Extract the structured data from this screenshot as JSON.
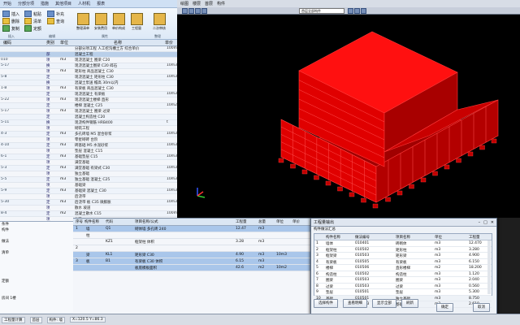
{
  "left_app": {
    "ribbon_tabs": [
      "开始",
      "分部分项",
      "措施",
      "其他项目",
      "人材机",
      "报表"
    ],
    "small_buttons": [
      "插入",
      "删除",
      "复制",
      "粘贴",
      "清单",
      "定额",
      "补充",
      "查询"
    ],
    "big_buttons": [
      "整理清单",
      "安装费用",
      "单价构成",
      "工程量",
      "二次审核"
    ],
    "groups": [
      "插入",
      "编辑",
      "属性",
      "整理"
    ],
    "headers": [
      "编码",
      "类别",
      "单位",
      "名称",
      "单价"
    ],
    "rows": [
      {
        "no": "",
        "type": "",
        "unit": "",
        "name": "分部分项工程 人工挖沟槽土方 综合单价",
        "qty": "100m3",
        "hl": false
      },
      {
        "no": "",
        "type": "部",
        "unit": "",
        "name": "混凝土工程",
        "qty": "",
        "hl": true
      },
      {
        "no": "010",
        "type": "项",
        "unit": "m3",
        "name": "现浇混凝土 圈梁 C20",
        "qty": "",
        "hl": false
      },
      {
        "no": "5-17",
        "type": "换",
        "unit": "",
        "name": "现浇混凝土圈梁 C20 碎石",
        "qty": "10m3",
        "hl": false
      },
      {
        "no": "",
        "type": "项",
        "unit": "m3",
        "name": "矩形柱 商品混凝土 C30",
        "qty": "",
        "hl": false
      },
      {
        "no": "5-8",
        "type": "定",
        "unit": "",
        "name": "现浇混凝土 矩形柱 C30",
        "qty": "10m3",
        "hl": false
      },
      {
        "no": "",
        "type": "换",
        "unit": "",
        "name": "混凝土泵送 檐高 30m以内",
        "qty": "",
        "hl": false
      },
      {
        "no": "1-B",
        "type": "项",
        "unit": "m3",
        "name": "有梁板 商品混凝土 C30",
        "qty": "",
        "hl": false
      },
      {
        "no": "",
        "type": "定",
        "unit": "",
        "name": "现浇混凝土 有梁板",
        "qty": "10m3",
        "hl": false
      },
      {
        "no": "5-22",
        "type": "项",
        "unit": "m3",
        "name": "现浇混凝土楼梯 直形",
        "qty": "",
        "hl": false
      },
      {
        "no": "",
        "type": "定",
        "unit": "",
        "name": "楼梯 混凝土 C25",
        "qty": "10m2",
        "hl": false
      },
      {
        "no": "5-17",
        "type": "项",
        "unit": "m3",
        "name": "现浇混凝土 圈梁 过梁",
        "qty": "",
        "hl": false
      },
      {
        "no": "",
        "type": "定",
        "unit": "",
        "name": "混凝土构造柱 C20",
        "qty": "",
        "hl": false
      },
      {
        "no": "5-11",
        "type": "换",
        "unit": "",
        "name": "现浇构件钢筋 HRB400",
        "qty": "t",
        "hl": false
      },
      {
        "no": "",
        "type": "项",
        "unit": "",
        "name": "砌筑工程",
        "qty": "",
        "hl": false
      },
      {
        "no": "4-3",
        "type": "定",
        "unit": "m3",
        "name": "多孔砖墙 M5 混合砂浆",
        "qty": "10m3",
        "hl": false
      },
      {
        "no": "",
        "type": "项",
        "unit": "",
        "name": "零星砌砖 台阶",
        "qty": "",
        "hl": false
      },
      {
        "no": "4-10",
        "type": "定",
        "unit": "m3",
        "name": "砖基础 M5 水泥砂浆",
        "qty": "10m3",
        "hl": false
      },
      {
        "no": "",
        "type": "项",
        "unit": "",
        "name": "垫层 混凝土 C15",
        "qty": "",
        "hl": false
      },
      {
        "no": "6-1",
        "type": "定",
        "unit": "m3",
        "name": "基础垫层 C15",
        "qty": "10m3",
        "hl": false
      },
      {
        "no": "",
        "type": "项",
        "unit": "",
        "name": "满堂基础",
        "qty": "",
        "hl": false
      },
      {
        "no": "5-3",
        "type": "定",
        "unit": "m3",
        "name": "满堂基础 有梁式 C30",
        "qty": "10m3",
        "hl": false
      },
      {
        "no": "",
        "type": "项",
        "unit": "",
        "name": "独立基础",
        "qty": "",
        "hl": false
      },
      {
        "no": "5-5",
        "type": "定",
        "unit": "m3",
        "name": "独立基础 混凝土 C25",
        "qty": "10m3",
        "hl": false
      },
      {
        "no": "",
        "type": "项",
        "unit": "",
        "name": "基础梁",
        "qty": "",
        "hl": false
      },
      {
        "no": "5-9",
        "type": "定",
        "unit": "m3",
        "name": "基础梁 混凝土 C30",
        "qty": "10m3",
        "hl": false
      },
      {
        "no": "",
        "type": "项",
        "unit": "",
        "name": "后浇带",
        "qty": "",
        "hl": false
      },
      {
        "no": "5-30",
        "type": "定",
        "unit": "m3",
        "name": "后浇带 板 C35 微膨胀",
        "qty": "10m3",
        "hl": false
      },
      {
        "no": "",
        "type": "项",
        "unit": "",
        "name": "散水 坡道",
        "qty": "",
        "hl": false
      },
      {
        "no": "8-4",
        "type": "定",
        "unit": "m2",
        "name": "混凝土散水 C15",
        "qty": "100m2",
        "hl": false
      },
      {
        "no": "",
        "type": "项",
        "unit": "",
        "name": "台阶",
        "qty": "",
        "hl": false
      },
      {
        "no": "8-9",
        "type": "定",
        "unit": "m2",
        "name": "混凝土台阶 C20",
        "qty": "10m2",
        "hl": false
      },
      {
        "no": "",
        "type": "项",
        "unit": "",
        "name": "压顶",
        "qty": "",
        "hl": false
      },
      {
        "no": "5-40",
        "type": "定",
        "unit": "m3",
        "name": "压顶 混凝土 C20",
        "qty": "10m3",
        "hl": false
      }
    ],
    "bottom_items": [
      "条件",
      "构件",
      "",
      "做法",
      "",
      "清单",
      "",
      "",
      "",
      "",
      "定额",
      "",
      "",
      "房间 1楼"
    ]
  },
  "viewport": {
    "tabs": [
      "绘图",
      "楼层",
      "首层",
      "构件"
    ],
    "view_select": "首层全部构件",
    "model_color": "#e00000"
  },
  "lower_table": {
    "headers": [
      "序号",
      "构件名称",
      "代码",
      "项目名称/公式",
      "工程量",
      "总量",
      "单位",
      "单价"
    ],
    "rows": [
      {
        "c1": "1",
        "c2": "墙",
        "c3": "Q1",
        "c4": "砌体墙 多孔砖 240",
        "c5": "12.47",
        "c6": "m3",
        "c7": "",
        "hl": true
      },
      {
        "c1": "",
        "c2": "柱",
        "c3": "",
        "c4": "",
        "c5": "",
        "c6": "",
        "c7": "",
        "hl": false
      },
      {
        "c1": "",
        "c2": "",
        "c3": "KZ1",
        "c4": "框架柱 体积",
        "c5": "3.28",
        "c6": "m3",
        "c7": "",
        "hl": false
      },
      {
        "c1": "2",
        "c2": "",
        "c3": "",
        "c4": "",
        "c5": "",
        "c6": "",
        "c7": "",
        "hl": false
      },
      {
        "c1": "",
        "c2": "梁",
        "c3": "KL1",
        "c4": "矩形梁 C30",
        "c5": "4.90",
        "c6": "m3",
        "c7": "10m3",
        "hl": true
      },
      {
        "c1": "3",
        "c2": "板",
        "c3": "B1",
        "c4": "有梁板 C30 体积",
        "c5": "6.15",
        "c6": "m3",
        "c7": "",
        "hl": true
      },
      {
        "c1": "",
        "c2": "",
        "c3": "",
        "c4": "板底模板面积",
        "c5": "42.6",
        "c6": "m2",
        "c7": "10m2",
        "hl": true
      }
    ]
  },
  "dialog": {
    "title": "工程量输出",
    "subtitle": "构件做法汇总",
    "headers": [
      "",
      "构件名称",
      "做法编号",
      "项目名称",
      "单位",
      "工程量"
    ],
    "rows": [
      {
        "a": "1",
        "b": "墙体",
        "c": "010401",
        "d": "砖砌体",
        "e": "m3",
        "f": "12.470"
      },
      {
        "a": "2",
        "b": "框架柱",
        "c": "010502",
        "d": "矩形柱",
        "e": "m3",
        "f": "3.280"
      },
      {
        "a": "3",
        "b": "框架梁",
        "c": "010503",
        "d": "矩形梁",
        "e": "m3",
        "f": "4.900"
      },
      {
        "a": "4",
        "b": "有梁板",
        "c": "010505",
        "d": "有梁板",
        "e": "m3",
        "f": "6.150"
      },
      {
        "a": "5",
        "b": "楼梯",
        "c": "010506",
        "d": "直形楼梯",
        "e": "m2",
        "f": "18.200"
      },
      {
        "a": "6",
        "b": "构造柱",
        "c": "010502",
        "d": "构造柱",
        "e": "m3",
        "f": "1.120"
      },
      {
        "a": "7",
        "b": "圈梁",
        "c": "010503",
        "d": "圈梁",
        "e": "m3",
        "f": "2.040"
      },
      {
        "a": "8",
        "b": "过梁",
        "c": "010503",
        "d": "过梁",
        "e": "m3",
        "f": "0.560"
      },
      {
        "a": "9",
        "b": "垫层",
        "c": "010501",
        "d": "垫层",
        "e": "m3",
        "f": "5.300"
      },
      {
        "a": "10",
        "b": "基础",
        "c": "010501",
        "d": "独立基础",
        "e": "m3",
        "f": "8.750"
      },
      {
        "a": "11",
        "b": "基础梁",
        "c": "010503",
        "d": "基础梁",
        "e": "m3",
        "f": "2.610"
      }
    ],
    "buttons": [
      "选择构件",
      "查看明细",
      "显示全部",
      "刷新"
    ],
    "ok": "确定",
    "cancel": "取消"
  },
  "status": [
    "工程量计算",
    "首层",
    "构件: 墙",
    "X=120.5 Y=86.3"
  ]
}
